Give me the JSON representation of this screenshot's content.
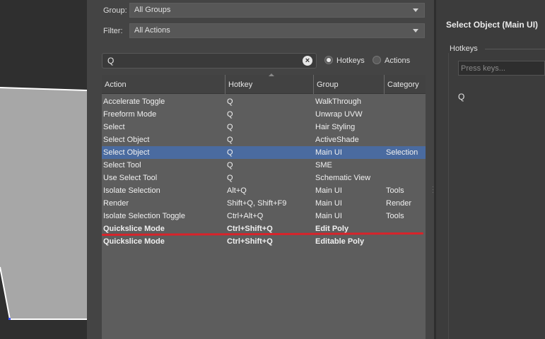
{
  "dialog": {
    "group_label": "Group:",
    "group_value": "All Groups",
    "filter_label": "Filter:",
    "filter_value": "All Actions",
    "search_value": "Q",
    "radio_hotkeys": "Hotkeys",
    "radio_actions": "Actions",
    "selected_radio": "Hotkeys"
  },
  "table": {
    "headers": [
      "Action",
      "Hotkey",
      "Group",
      "Category"
    ],
    "rows": [
      {
        "action": "Accelerate Toggle",
        "hotkey": "Q",
        "group": "WalkThrough",
        "category": ""
      },
      {
        "action": "Freeform Mode",
        "hotkey": "Q",
        "group": "Unwrap UVW",
        "category": ""
      },
      {
        "action": "Select",
        "hotkey": "Q",
        "group": "Hair Styling",
        "category": ""
      },
      {
        "action": "Select Object",
        "hotkey": "Q",
        "group": "ActiveShade",
        "category": ""
      },
      {
        "action": "Select Object",
        "hotkey": "Q",
        "group": "Main UI",
        "category": "Selection",
        "selected": true
      },
      {
        "action": "Select Tool",
        "hotkey": "Q",
        "group": "SME",
        "category": ""
      },
      {
        "action": "Use Select Tool",
        "hotkey": "Q",
        "group": "Schematic View",
        "category": ""
      },
      {
        "action": "Isolate Selection",
        "hotkey": "Alt+Q",
        "group": "Main UI",
        "category": "Tools"
      },
      {
        "action": "Render",
        "hotkey": "Shift+Q, Shift+F9",
        "group": "Main UI",
        "category": "Render"
      },
      {
        "action": "Isolate Selection Toggle",
        "hotkey": "Ctrl+Alt+Q",
        "group": "Main UI",
        "category": "Tools"
      },
      {
        "action": "Quickslice Mode",
        "hotkey": "Ctrl+Shift+Q",
        "group": "Edit Poly",
        "category": "",
        "bold": true
      },
      {
        "action": "Quickslice Mode",
        "hotkey": "Ctrl+Shift+Q",
        "group": "Editable Poly",
        "category": "",
        "bold": true
      }
    ]
  },
  "details": {
    "title": "Select Object (Main UI)",
    "hotkeys_label": "Hotkeys",
    "press_keys_placeholder": "Press keys...",
    "assigned_key": "Q"
  },
  "colors": {
    "selection_row": "#4a6ba0",
    "annotation_underline": "#d9232a"
  }
}
